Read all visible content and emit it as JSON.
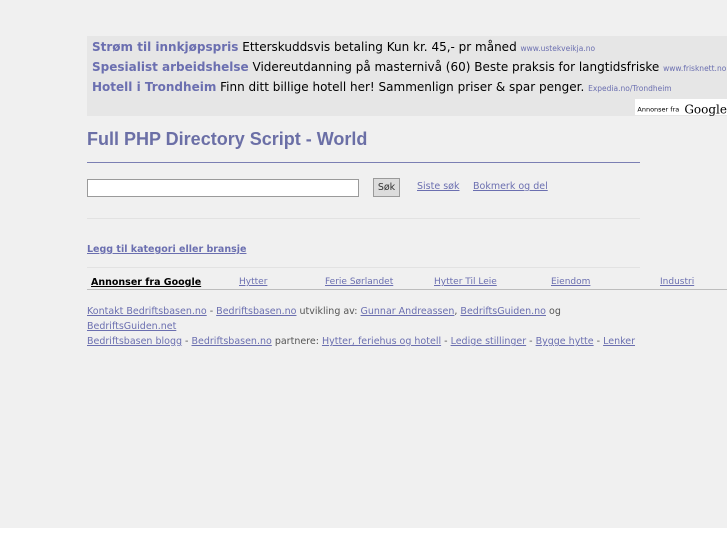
{
  "ads": [
    {
      "title": "Strøm til innkjøpspris",
      "text": "Etterskuddsvis betaling Kun kr. 45,- pr måned",
      "url": "www.ustekveikja.no"
    },
    {
      "title": "Spesialist arbeidshelse",
      "text": "Videreutdanning på masternivå (60) Beste praksis for langtidsfriske",
      "url": "www.frisknett.no"
    },
    {
      "title": "Hotell i Trondheim",
      "text": "Finn ditt billige hotell her! Sammenlign priser & spar penger.",
      "url": "Expedia.no/Trondheim"
    }
  ],
  "ad_attribution": {
    "small": "Annonser fra",
    "brand": "Google"
  },
  "page_title": "Full PHP Directory Script - World",
  "search": {
    "value": "",
    "button_label": "Søk"
  },
  "top_links": {
    "recent": "Siste søk",
    "bookmark": "Bokmerk og del"
  },
  "add_category": "Legg til kategori eller bransje",
  "links_bar": {
    "heading": "Annonser fra Google",
    "items": [
      "Hytter",
      "Ferie Sørlandet",
      "Hytter Til Leie",
      "Eiendom",
      "Industri"
    ]
  },
  "footer": {
    "line1": {
      "contact": "Kontakt Bedriftsbasen.no",
      "sep1": " - ",
      "site": "Bedriftsbasen.no",
      "dev_text": " utvikling av: ",
      "person": "Gunnar Andreassen",
      "comma": ", ",
      "guide": "BedriftsGuiden.no",
      "og": " og",
      "guide_net": "BedriftsGuiden.net"
    },
    "line2": {
      "blog": "Bedriftsbasen blogg",
      "sep1": " - ",
      "site": "Bedriftsbasen.no",
      "partners_text": " partnere: ",
      "hytter": "Hytter, feriehus og hotell",
      "sep2": " - ",
      "jobs": "Ledige stillinger",
      "sep3": " - ",
      "cabin": "Bygge hytte",
      "sep4": " - ",
      "links": "Lenker"
    }
  }
}
